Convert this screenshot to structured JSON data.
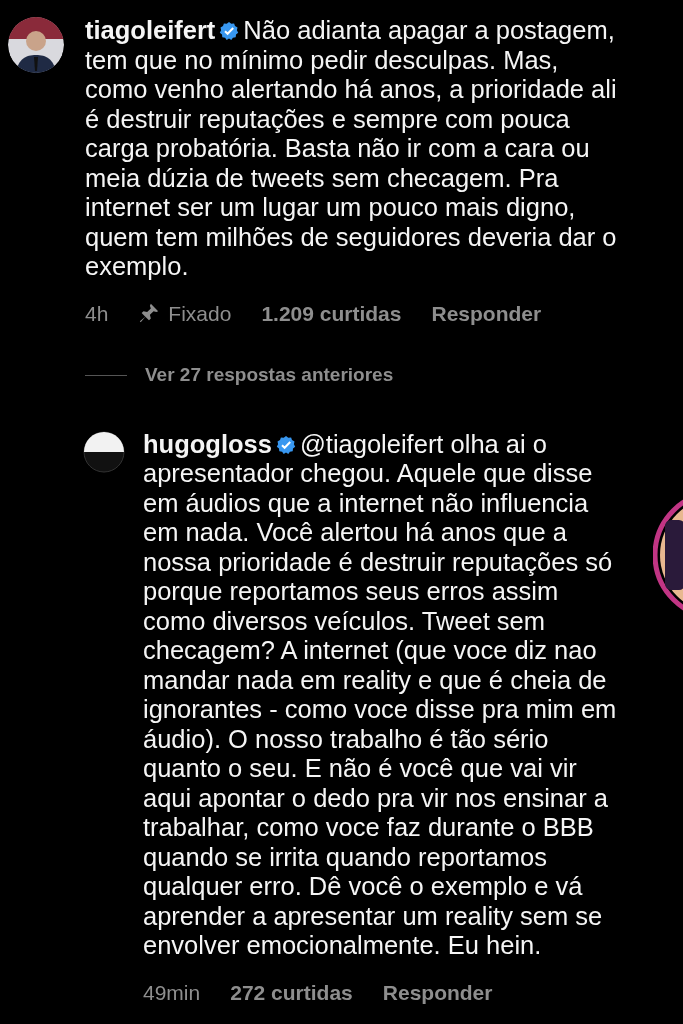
{
  "comments": [
    {
      "username": "tiagoleifert",
      "verified": true,
      "text": "Não adianta apagar a postagem,\ntem que no mínimo pedir desculpas. Mas,\ncomo venho alertando há anos, a prioridade ali\né destruir reputações e sempre com pouca\ncarga probatória. Basta não ir com a cara ou\nmeia dúzia de tweets sem checagem. Pra\ninternet ser um lugar um pouco mais digno,\nquem tem milhões de seguidores deveria dar o\nexemplo.",
      "time": "4h",
      "pinned": true,
      "pinned_label": "Fixado",
      "likes": "1.209 curtidas",
      "reply": "Responder",
      "view_replies": "Ver 27 respostas anteriores"
    },
    {
      "username": "hugogloss",
      "verified": true,
      "text": "@tiagoleifert olha ai o\napresentador chegou. Aquele que disse\nem áudios que a internet não influencia\nem nada. Você alertou há anos que a\nnossa prioridade é destruir reputações só\nporque reportamos seus erros assim\ncomo diversos veículos. Tweet sem\nchecagem? A internet (que voce diz nao\nmandar nada em reality e que é cheia de\nignorantes - como voce disse pra mim em\náudio). O nosso trabalho é tão sério\nquanto o seu. E não é você que vai vir\naqui apontar o dedo pra vir nos ensinar a\ntrabalhar, como voce faz durante o BBB\nquando se irrita quando reportamos\nqualquer erro. Dê você o exemplo e vá\naprender a apresentar um reality sem se\nenvolver emocionalmente. Eu hein.",
      "time": "49min",
      "pinned": false,
      "likes": "272 curtidas",
      "reply": "Responder"
    }
  ]
}
